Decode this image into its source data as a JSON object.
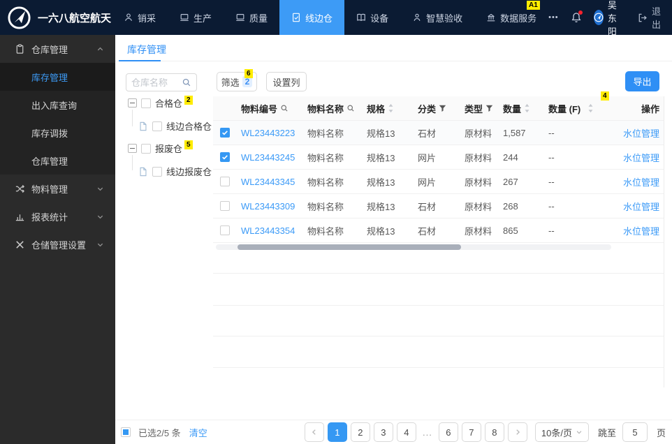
{
  "colors": {
    "accent": "#3598f3",
    "nav_bg": "#0b1b33",
    "sidebar_bg": "#2b2b2b",
    "mark_bg": "#ffec00",
    "active_tab_bg": "#3d9bf6"
  },
  "topnav": {
    "brand": "一六八航空航天",
    "items": [
      {
        "label": "销采"
      },
      {
        "label": "生产"
      },
      {
        "label": "质量"
      },
      {
        "label": "线边仓"
      },
      {
        "label": "设备"
      },
      {
        "label": "智慧验收"
      },
      {
        "label": "数据服务"
      }
    ],
    "more": "•••",
    "username": "吴东阳",
    "logout": "退出"
  },
  "marks": {
    "bell": "A1",
    "filter": "6",
    "qualified": "2",
    "scrap": "5",
    "qty_col": "4"
  },
  "sidebar": {
    "groups": [
      {
        "label": "仓库管理"
      },
      {
        "label": "物料管理"
      },
      {
        "label": "报表统计"
      },
      {
        "label": "仓储管理设置"
      }
    ],
    "sub_items": [
      {
        "label": "库存管理"
      },
      {
        "label": "出入库查询"
      },
      {
        "label": "库存调拨"
      },
      {
        "label": "仓库管理"
      }
    ]
  },
  "content": {
    "tab": "库存管理",
    "tree": {
      "search_placeholder": "仓库名称",
      "parent1": "合格仓",
      "child1": "线边合格仓",
      "parent2": "报废仓",
      "child2": "线边报废仓"
    },
    "toolbar": {
      "filter": "筛选",
      "filter_count": "2",
      "set_columns": "设置列",
      "export": "导出"
    },
    "table": {
      "headers": {
        "code": "物料编号",
        "name": "物料名称",
        "spec": "规格",
        "category": "分类",
        "type": "类型",
        "qty": "数量",
        "qty_f": "数量 (F)",
        "action": "操作"
      },
      "rows": [
        {
          "checked": true,
          "code": "WL23443223",
          "name": "物料名称",
          "spec": "规格13",
          "category": "石材",
          "type": "原材料",
          "qty": "1,587",
          "qty_f": "--",
          "action": "水位管理"
        },
        {
          "checked": true,
          "code": "WL23443245",
          "name": "物料名称",
          "spec": "规格13",
          "category": "网片",
          "type": "原材料",
          "qty": "244",
          "qty_f": "--",
          "action": "水位管理"
        },
        {
          "checked": false,
          "code": "WL23443345",
          "name": "物料名称",
          "spec": "规格13",
          "category": "网片",
          "type": "原材料",
          "qty": "267",
          "qty_f": "--",
          "action": "水位管理"
        },
        {
          "checked": false,
          "code": "WL23443309",
          "name": "物料名称",
          "spec": "规格13",
          "category": "石材",
          "type": "原材料",
          "qty": "268",
          "qty_f": "--",
          "action": "水位管理"
        },
        {
          "checked": false,
          "code": "WL23443354",
          "name": "物料名称",
          "spec": "规格13",
          "category": "石材",
          "type": "原材料",
          "qty": "865",
          "qty_f": "--",
          "action": "水位管理"
        }
      ]
    },
    "footer": {
      "selected": "已选2/5 条",
      "clear": "清空",
      "pages": [
        "1",
        "2",
        "3",
        "4",
        "6",
        "7",
        "8"
      ],
      "ellipsis": "...",
      "page_size": "10条/页",
      "jump_label": "跳至",
      "jump_value": "5",
      "jump_suffix": "页"
    }
  }
}
